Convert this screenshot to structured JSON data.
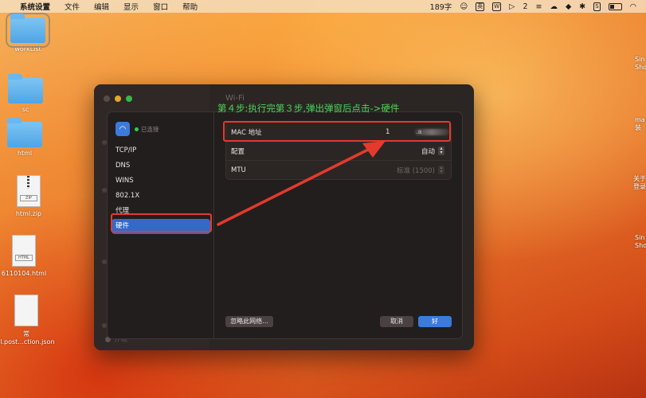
{
  "menubar": {
    "app": "系统设置",
    "items": [
      "文件",
      "编辑",
      "显示",
      "窗口",
      "帮助"
    ],
    "word_count": "189字",
    "badge_text": "英",
    "box_icon_text": "W",
    "count_badge": "2"
  },
  "desktop": {
    "icons": [
      {
        "label": "workList"
      },
      {
        "label": "sc"
      },
      {
        "label": "html"
      },
      {
        "label": "html.zip"
      },
      {
        "label": "6110104.html"
      },
      {
        "label_line1": "常",
        "label_line2": "il.post...ction.json"
      }
    ],
    "right_labels": [
      "Sin\nSho",
      "ma\n装",
      "关于\n登录",
      "Sin\nSho"
    ]
  },
  "window": {
    "title": "Wi-Fi",
    "footer_ghost": "外观"
  },
  "instruction": "第４步:执行完第３步,弹出弹窗后点击->硬件",
  "sheet": {
    "connection_status": "已连接",
    "sidebar": [
      {
        "label": "TCP/IP",
        "active": false
      },
      {
        "label": "DNS",
        "active": false
      },
      {
        "label": "WINS",
        "active": false
      },
      {
        "label": "802.1X",
        "active": false
      },
      {
        "label": "代理",
        "active": false
      },
      {
        "label": "硬件",
        "active": true
      }
    ],
    "form": {
      "mac_label": "MAC 地址",
      "mac_value": "1",
      "mac_suffix": ".a",
      "config_label": "配置",
      "config_value": "自动",
      "mtu_label": "MTU",
      "mtu_value": "标准 (1500)"
    },
    "buttons": {
      "forget": "忽略此网络...",
      "cancel": "取消",
      "ok": "好"
    }
  },
  "colors": {
    "accent": "#3a7bdc",
    "highlight": "#e33a2d",
    "instruction": "#4cd35a"
  }
}
